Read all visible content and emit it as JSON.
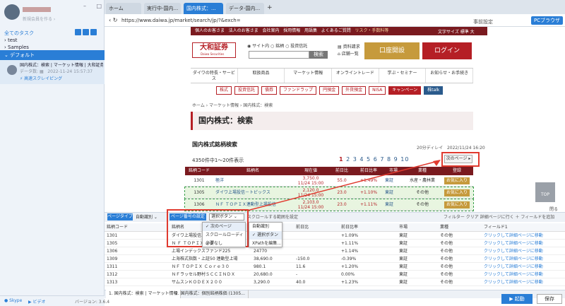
{
  "sidebar": {
    "account_sub": "新規会員を作る  ›",
    "tree_header": "全てのタスク",
    "items": [
      "test",
      "Samples"
    ],
    "default_group": "デフォルト",
    "task": {
      "title": "国内株式：検索 | マーケット情報 | 大和証券",
      "meta_label": "データ数:",
      "date": "2022-11-24 15:57:37",
      "action": "高速スクレイピング"
    },
    "skype": "Skype",
    "video": "ビデオ",
    "version": "バージョン: 3.6.4"
  },
  "browser": {
    "tabs": [
      "ホーム",
      "実行中-国内...",
      "国内株式：...",
      "データ-国内..."
    ],
    "url": "https://www.daiwa.jp/market/search/jp/?&exch=",
    "page_settings": "事前設定",
    "pc_browser": "PCブラウザ"
  },
  "site": {
    "topnav": [
      "個人のお客さま",
      "法人のお客さま",
      "会社案内",
      "採用情報",
      "用語集",
      "よくあるご質問"
    ],
    "risk": "リスク・手数料等",
    "fontsize": "文字サイズ  標準  大",
    "brand": "大和証券",
    "brand_sub": "Daiwa Securities",
    "search_radios": "◉ サイト内  ○ 銘柄  ○ 投資信託",
    "search_button": "検索",
    "side_links": [
      "資料請求",
      "店舗一覧"
    ],
    "open_account": "口座開設",
    "login": "ログイン",
    "mainnav": [
      "ダイワの特長・サービス",
      "取扱商品",
      "マーケット情報",
      "オンライントレード",
      "学ぶ・セミナー",
      "お知らせ・お手続き"
    ],
    "subnav": [
      "株式",
      "投資信託",
      "債券",
      "ファンドラップ",
      "円預金",
      "外貨預金",
      "NISA",
      "キャンペーン",
      "株talk"
    ],
    "breadcrumb": "ホーム  ›  マーケット情報  ›  国内株式：検索",
    "page_title": "国内株式：検索",
    "section_title": "国内株式銘柄検索",
    "delay": "20分ディレイ",
    "date": "2022/11/24 16:20",
    "count_text": "4350件中1～20件表示",
    "pager": [
      "1",
      "2",
      "3",
      "4",
      "5",
      "6",
      "7",
      "8",
      "9",
      "10"
    ],
    "next_page": "次のページ",
    "table_headers": [
      "銘柄コード",
      "銘柄名",
      "現在値",
      "前日比",
      "前日比率",
      "市場",
      "業種",
      "登録"
    ],
    "rows": [
      {
        "code": "1301",
        "name": "極洋",
        "price": "3,750.0\n11/24 15:00",
        "chg": "55.0",
        "pct": "+1.49%",
        "mkt": "東証",
        "ind": "水産・農林業",
        "fav": "お気に入り"
      },
      {
        "code": "1305",
        "name": "ダイワ上場投信－トピックス",
        "price": "2,120.0\n11/24 15:00",
        "chg": "23.0",
        "pct": "+1.10%",
        "mkt": "東証",
        "ind": "その他",
        "fav": "お気に入り"
      },
      {
        "code": "1306",
        "name": "ＮＦ ＴＯＰＩＸ連動型上場投信",
        "price": "2,103.0\n11/24 15:00",
        "chg": "23.0",
        "pct": "+1.11%",
        "mkt": "東証",
        "ind": "その他",
        "fav": "お気に入り"
      }
    ],
    "top_button": "TOP",
    "close_chip": "閉る"
  },
  "panel": {
    "pagetype_label": "ページタイプ",
    "pagetype_value": "自動識別",
    "pagecount_label": "ページ番号の設定",
    "pagecount_value": "選択ボタン",
    "scroll_range": "スクロールする範囲を設定",
    "tools": "フィルター  クリア  詳細ページに行く  ＋ フィールドを追加",
    "dropdown": [
      "次のページ",
      "スクロールローディング",
      "必要なし"
    ],
    "context": [
      "自動識別",
      "選択ボタン",
      "XPathを編集..."
    ],
    "grid_headers": [
      "銘柄コード",
      "銘柄名",
      "",
      "前日比",
      "前日比率",
      "市場",
      "業種",
      "フィールド1"
    ],
    "grid_rows": [
      [
        "1301",
        "ダイワ上場投信…",
        "",
        "",
        "+1.09%",
        "東証",
        "その他",
        "クリックして詳細ページに移動"
      ],
      [
        "1305",
        "Ｎ Ｆ ＴＯＰＩＸ…",
        "",
        "",
        "+1.11%",
        "東証",
        "その他",
        "クリックして詳細ページに移動"
      ],
      [
        "1306",
        "上場インデックスファンド225",
        "24770",
        "",
        "+1.14%",
        "東証",
        "その他",
        "クリックして詳細ページに移動"
      ],
      [
        "1309",
        "上海株式指数・上証50 連動型上場",
        "38,690.0",
        "-150.0",
        "-0.39%",
        "東証",
        "その他",
        "クリックして詳細ページに移動"
      ],
      [
        "1311",
        "ＮＦ ＴＯＰＩＸ Ｃｏｒｅ３０",
        "980.1",
        "11.6",
        "+1.20%",
        "東証",
        "その他",
        "クリックして詳細ページに移動"
      ],
      [
        "1312",
        "ＮＦラッセル野村ＳＣＣＩＮＤＸ",
        "20,680.0",
        "-",
        "0.00%",
        "東証",
        "その他",
        "クリックして詳細ページに移動"
      ],
      [
        "1313",
        "サムスンＫＯＤＥＸ２００",
        "3,290.0",
        "40.0",
        "+1.23%",
        "東証",
        "その他",
        "クリックして詳細ページに移動"
      ]
    ],
    "bottom_tabs": [
      "1. 国内株式：検索 | マーケット情報",
      "2. 国内株式：個別銘柄株価 (1305..."
    ],
    "run": "▶ 起動",
    "save": "保存"
  }
}
